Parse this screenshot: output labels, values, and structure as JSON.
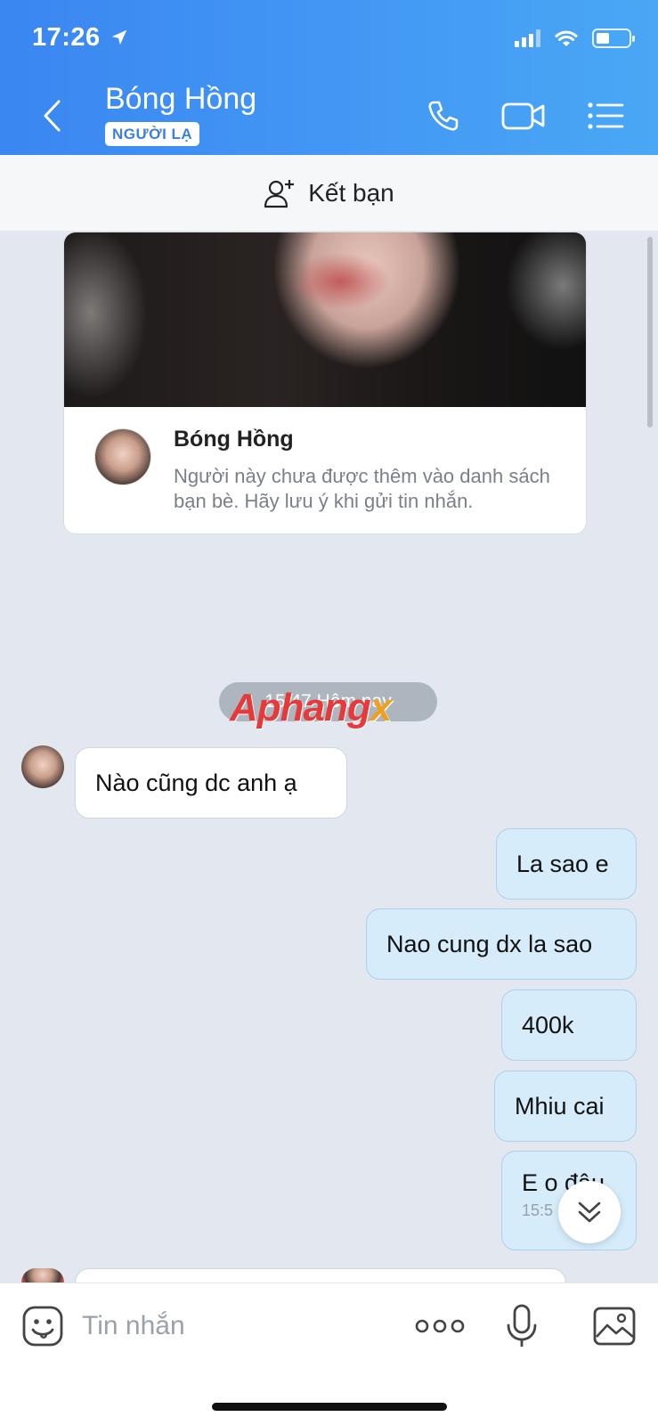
{
  "status_bar": {
    "time": "17:26",
    "icons": [
      "location-arrow-icon",
      "signal-icon",
      "wifi-icon",
      "battery-icon"
    ]
  },
  "header": {
    "title": "Bóng Hồng",
    "badge": "NGƯỜI LẠ",
    "icons": [
      "back-chevron-icon",
      "phone-icon",
      "video-camera-icon",
      "menu-list-icon"
    ]
  },
  "add_friend": {
    "label": "Kết bạn",
    "icon": "add-person-icon"
  },
  "profile_card": {
    "name": "Bóng Hồng",
    "note": "Người này chưa được thêm vào danh sách bạn bè. Hãy lưu ý khi gửi tin nhắn."
  },
  "timestamp": "15:47 Hôm nay",
  "watermark": {
    "main": "Aphang",
    "accent": "x"
  },
  "messages": [
    {
      "direction": "in",
      "text": "Nào cũng dc anh ạ"
    },
    {
      "direction": "out",
      "text": "La sao e"
    },
    {
      "direction": "out",
      "text": "Nao cung dx la sao"
    },
    {
      "direction": "out",
      "text": "400k"
    },
    {
      "direction": "out",
      "text": "Mhiu cai"
    },
    {
      "direction": "out",
      "text": "E o đâu",
      "time": "15:5"
    }
  ],
  "input": {
    "placeholder": "Tin nhắn",
    "icons": [
      "sticker-icon",
      "more-dots-icon",
      "microphone-icon",
      "image-icon"
    ]
  },
  "colors": {
    "header_start": "#3a86f2",
    "header_end": "#4aa7f5",
    "out_bubble": "#d6ecfb",
    "background": "#e3e8f0"
  }
}
